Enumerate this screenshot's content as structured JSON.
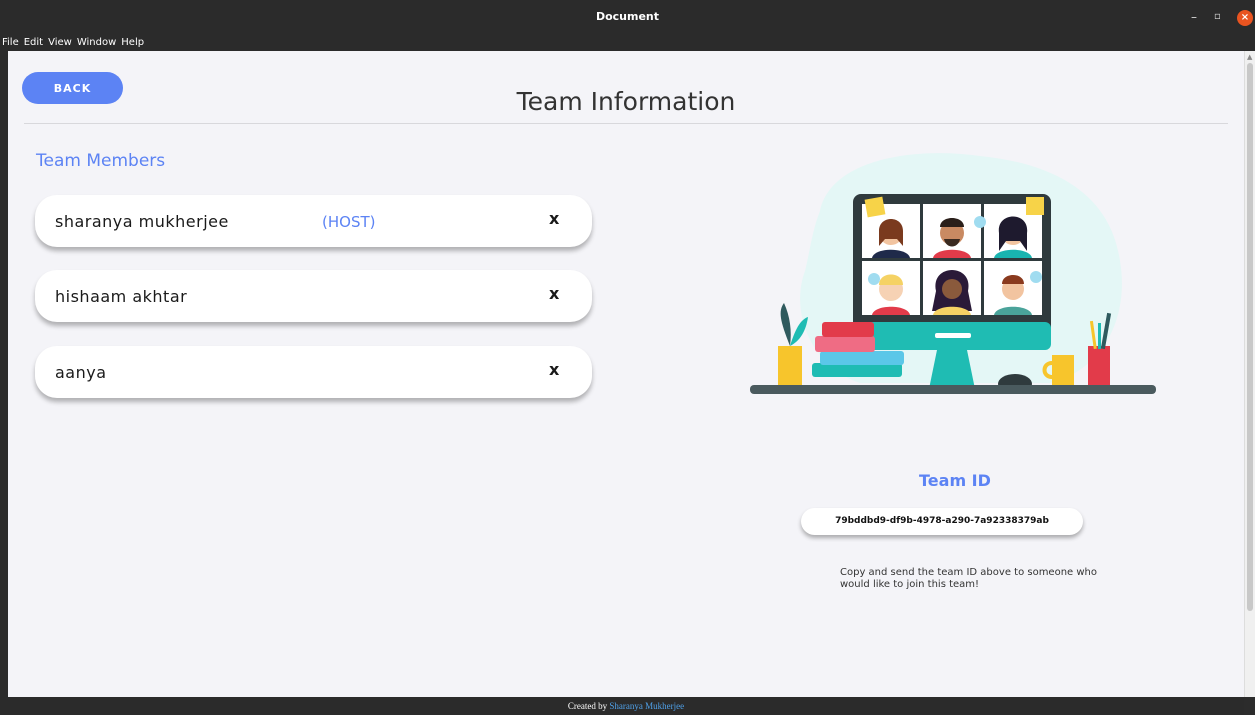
{
  "window": {
    "title": "Document",
    "minimize": "–",
    "maximize": "▫",
    "close": "×"
  },
  "menu": [
    "File",
    "Edit",
    "View",
    "Window",
    "Help"
  ],
  "header": {
    "back_label": "BACK",
    "page_title": "Team Information"
  },
  "members_section": {
    "title": "Team Members",
    "members": [
      {
        "name": "sharanya mukherjee",
        "tag": "(HOST)",
        "remove": "x"
      },
      {
        "name": "hishaam akhtar",
        "tag": "",
        "remove": "x"
      },
      {
        "name": "aanya",
        "tag": "",
        "remove": "x"
      }
    ]
  },
  "team_id": {
    "label": "Team ID",
    "value": "79bddbd9-df9b-4978-a290-7a92338379ab",
    "hint": "Copy and send the team ID above to someone who would like to join this team!"
  },
  "footer": {
    "prefix": "Created by",
    "author": "Sharanya Mukherjee"
  },
  "colors": {
    "accent": "#5c83f4",
    "background": "#f4f4f8",
    "chrome": "#2b2b2b"
  }
}
